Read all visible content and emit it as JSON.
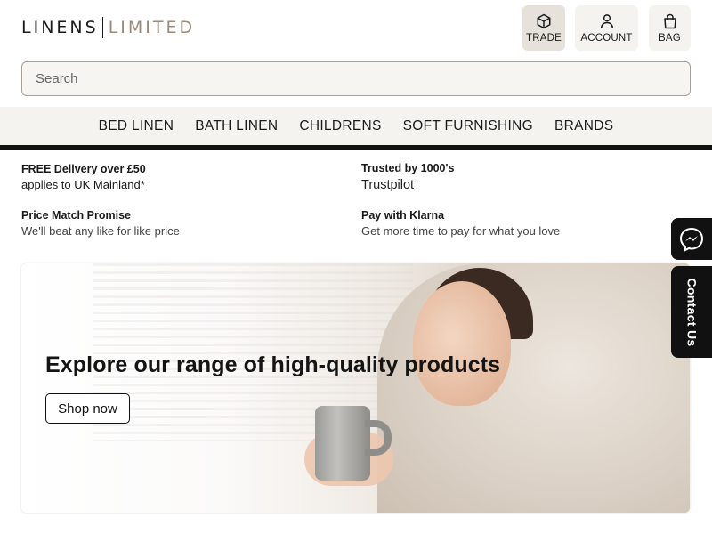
{
  "brand": {
    "part1": "LINENS",
    "part2": "LIMITED"
  },
  "header_buttons": {
    "trade": "TRADE",
    "account": "ACCOUNT",
    "bag": "BAG"
  },
  "search": {
    "placeholder": "Search"
  },
  "nav": {
    "items": [
      "BED LINEN",
      "BATH LINEN",
      "CHILDRENS",
      "SOFT FURNISHING",
      "BRANDS"
    ]
  },
  "usps": [
    {
      "title": "FREE Delivery over £50",
      "subtitle": "applies to UK Mainland*"
    },
    {
      "title": "Trusted by 1000's",
      "subtitle": "Trustpilot"
    },
    {
      "title": "Price Match Promise",
      "subtitle": "We'll beat any like for like price"
    },
    {
      "title": "Pay with Klarna",
      "subtitle": "Get more time to pay for what you love"
    }
  ],
  "hero": {
    "title": "Explore our range of high-quality products",
    "cta": "Shop now"
  },
  "widgets": {
    "messenger_icon": "messenger-icon",
    "contact_label": "Contact Us"
  },
  "colors": {
    "nav_bg": "#f5f3ef",
    "accent_dark": "#111111",
    "logo_secondary": "#9a8a7a"
  }
}
